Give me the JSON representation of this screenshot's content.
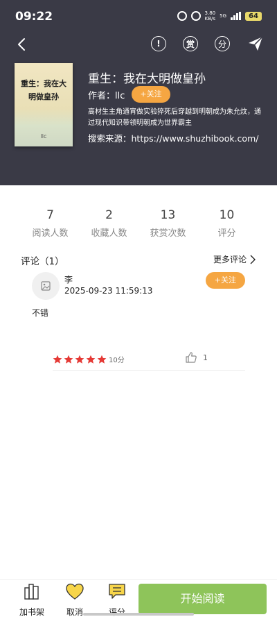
{
  "status_bar": {
    "time": "09:22",
    "speed_value": "3.80",
    "speed_unit": "KB/s",
    "network": "5G",
    "battery": "64"
  },
  "nav": {
    "icons": [
      "back-icon",
      "report-icon",
      "reward-icon",
      "rating-icon",
      "share-icon"
    ],
    "reward_glyph": "赏",
    "rating_glyph": "分"
  },
  "book": {
    "cover_title": "重生：我在大明做皇孙",
    "cover_author": "llc",
    "title": "重生：我在大明做皇孙",
    "author": "作者：llc",
    "follow_label": "+关注",
    "description": "高材生主角通宵做实验猝死后穿越到明朝成为朱允炆，通过现代知识带领明朝成为世界霸主",
    "source": "搜索来源：https://www.shuzhibook.com/"
  },
  "stats": [
    {
      "value": "7",
      "label": "阅读人数"
    },
    {
      "value": "2",
      "label": "收藏人数"
    },
    {
      "value": "13",
      "label": "获赏次数"
    },
    {
      "value": "10",
      "label": "评分"
    }
  ],
  "comments": {
    "title": "评论（1）",
    "more_label": "更多评论",
    "items": [
      {
        "user": "李",
        "time": "2025-09-23 11:59:13",
        "follow_label": "+关注",
        "text": "不错",
        "stars": 5,
        "score": "10分",
        "likes": "1"
      }
    ]
  },
  "bottom_bar": {
    "shelf_label": "加书架",
    "cancel_label": "取消",
    "rate_label": "评分",
    "read_label": "开始阅读"
  },
  "colors": {
    "header_bg": "#3a3a46",
    "accent_orange": "#f5a642",
    "read_green": "#8ec45a",
    "star_red": "#e53935"
  }
}
